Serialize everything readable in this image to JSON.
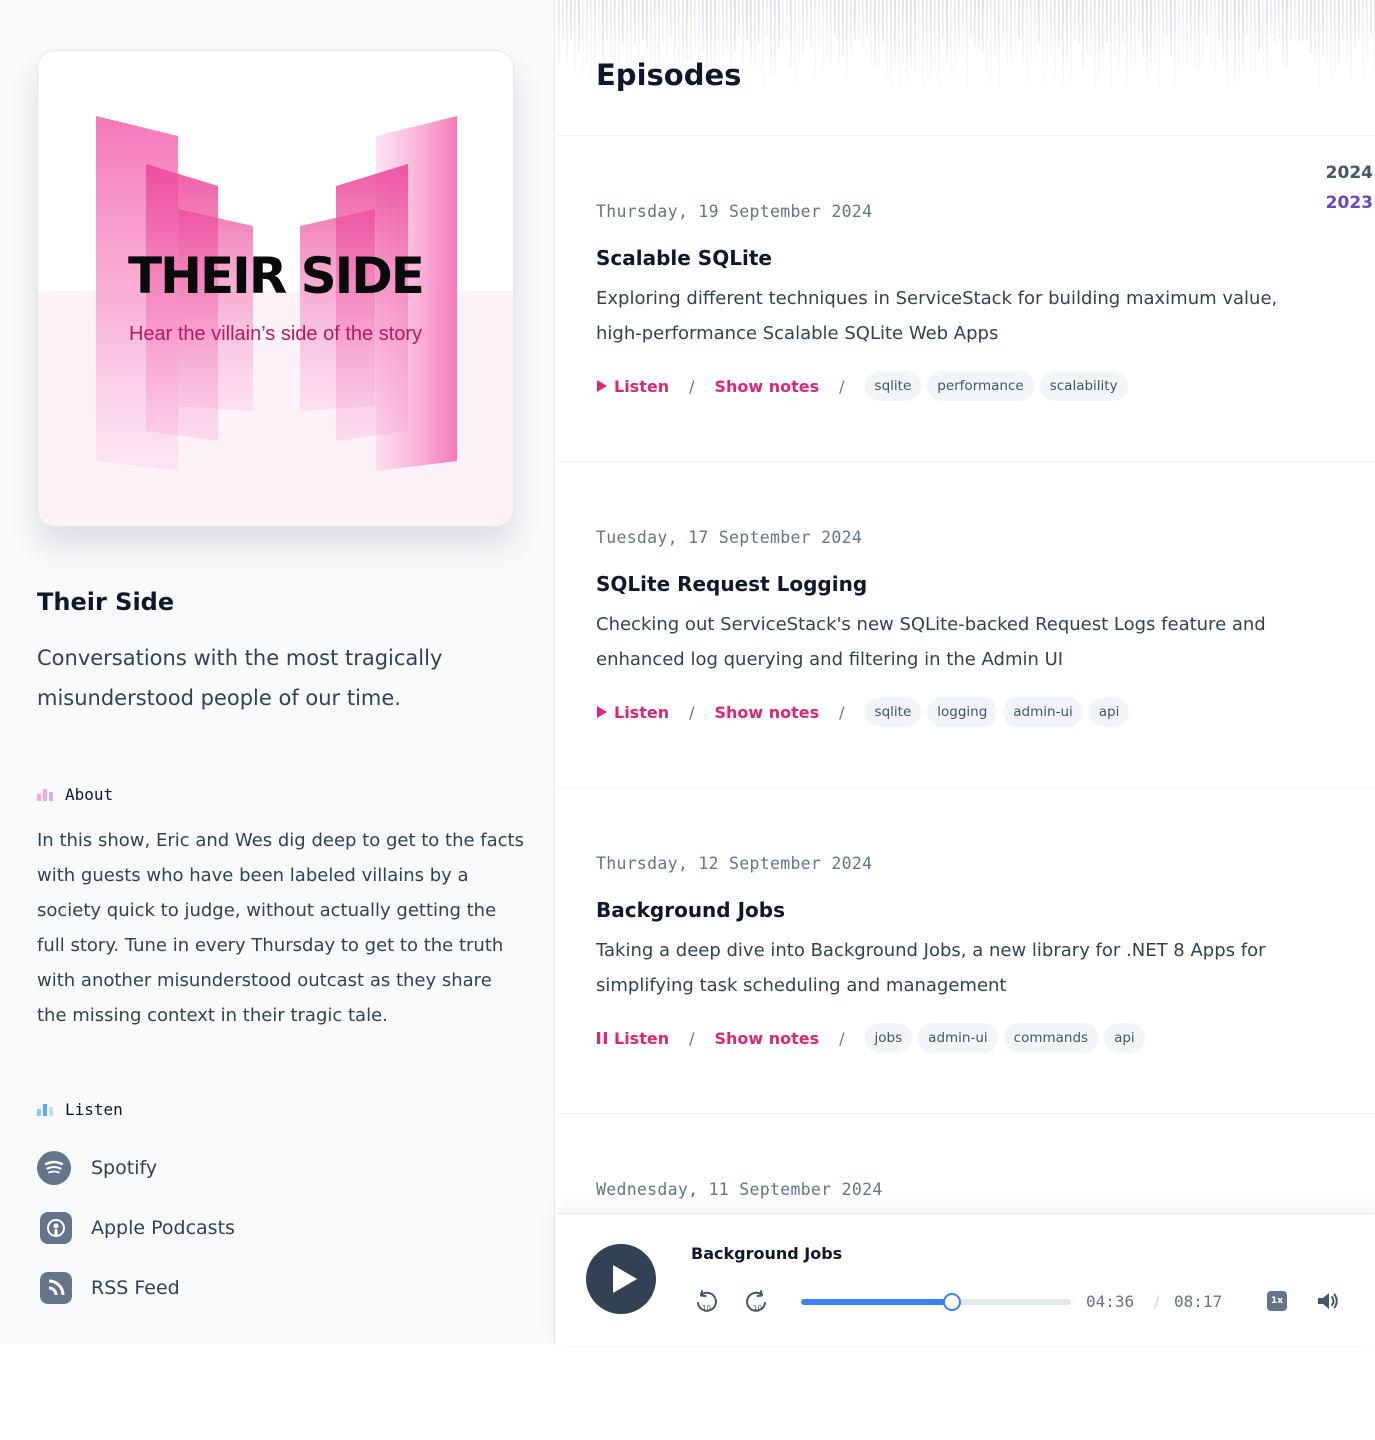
{
  "podcast": {
    "cover_title": "THEIR SIDE",
    "cover_subtitle": "Hear the villain’s side of the story",
    "title": "Their Side",
    "description": "Conversations with the most tragically misunderstood people of our time."
  },
  "about": {
    "heading": "About",
    "text": "In this show, Eric and Wes dig deep to get to the facts with guests who have been labeled villains by a society quick to judge, without actually getting the full story. Tune in every Thursday to get to the truth with another misunderstood outcast as they share the missing context in their tragic tale."
  },
  "listen": {
    "heading": "Listen",
    "links": [
      {
        "label": "Spotify",
        "icon": "spotify-icon"
      },
      {
        "label": "Apple Podcasts",
        "icon": "apple-podcasts-icon"
      },
      {
        "label": "RSS Feed",
        "icon": "rss-icon"
      }
    ]
  },
  "main": {
    "title": "Episodes",
    "years": [
      "2024",
      "2023"
    ],
    "selected_year": "2023"
  },
  "episodes": [
    {
      "date": "Thursday, 19 September 2024",
      "title": "Scalable SQLite",
      "description": "Exploring different techniques in ServiceStack for building maximum value, high-performance Scalable SQLite Web Apps",
      "listen_label": "Listen",
      "listen_icon": "play-icon",
      "notes_label": "Show notes",
      "tags": [
        "sqlite",
        "performance",
        "scalability"
      ]
    },
    {
      "date": "Tuesday, 17 September 2024",
      "title": "SQLite Request Logging",
      "description": "Checking out ServiceStack's new SQLite-backed Request Logs feature and enhanced log querying and filtering in the Admin UI",
      "listen_label": "Listen",
      "listen_icon": "play-icon",
      "notes_label": "Show notes",
      "tags": [
        "sqlite",
        "logging",
        "admin-ui",
        "api"
      ]
    },
    {
      "date": "Thursday, 12 September 2024",
      "title": "Background Jobs",
      "description": "Taking a deep dive into Background Jobs, a new library for .NET 8 Apps for simplifying task scheduling and management",
      "listen_label": "Listen",
      "listen_icon": "pause-icon",
      "notes_label": "Show notes",
      "tags": [
        "jobs",
        "admin-ui",
        "commands",
        "api"
      ]
    },
    {
      "date": "Wednesday, 11 September 2024",
      "title": "",
      "description": "",
      "listen_label": "",
      "listen_icon": "",
      "notes_label": "",
      "tags": []
    }
  ],
  "player": {
    "title": "Background Jobs",
    "current_time": "04:36",
    "separator": "/",
    "duration": "08:17",
    "progress": 0.555,
    "speed_label": "1x"
  },
  "colors": {
    "accent": "#db2777",
    "progress": "#3b82f6",
    "year_selected": "#6b46c1",
    "play_button": "#334155"
  }
}
